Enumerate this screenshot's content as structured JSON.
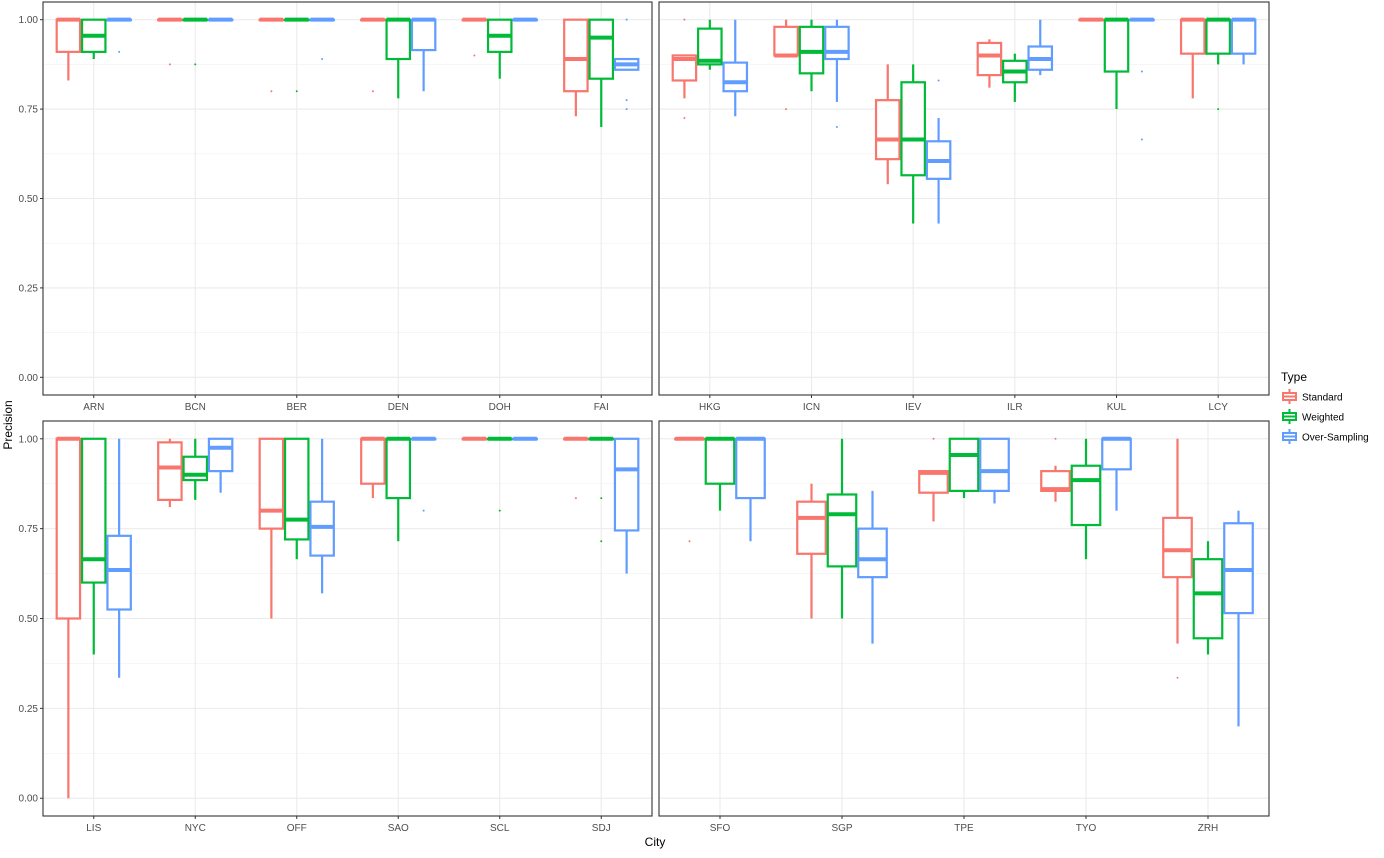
{
  "chart_data": {
    "type": "box",
    "x_axis_title": "City",
    "y_axis_title": "Precision",
    "y_ticks": [
      "0.00",
      "0.25",
      "0.50",
      "0.75",
      "1.00"
    ],
    "ylim": [
      0,
      1
    ],
    "grid": true,
    "legend": {
      "title": "Type",
      "position": "right",
      "items": [
        {
          "name": "Standard",
          "color": "#F8766D"
        },
        {
          "name": "Weighted",
          "color": "#00BA38"
        },
        {
          "name": "Over-Sampling",
          "color": "#619CFF"
        }
      ]
    },
    "panels": [
      {
        "cities": [
          {
            "city": "ARN",
            "boxes": [
              {
                "min": 0.83,
                "q1": 0.91,
                "median": 1.0,
                "q3": 1.0,
                "max": 1.0,
                "outliers": []
              },
              {
                "min": 0.89,
                "q1": 0.91,
                "median": 0.955,
                "q3": 1.0,
                "max": 1.0,
                "outliers": []
              },
              {
                "min": 1.0,
                "q1": 1.0,
                "median": 1.0,
                "q3": 1.0,
                "max": 1.0,
                "outliers": [
                  0.91
                ]
              }
            ]
          },
          {
            "city": "BCN",
            "boxes": [
              {
                "min": 1.0,
                "q1": 1.0,
                "median": 1.0,
                "q3": 1.0,
                "max": 1.0,
                "outliers": [
                  0.875
                ]
              },
              {
                "min": 1.0,
                "q1": 1.0,
                "median": 1.0,
                "q3": 1.0,
                "max": 1.0,
                "outliers": [
                  0.875
                ]
              },
              {
                "min": 1.0,
                "q1": 1.0,
                "median": 1.0,
                "q3": 1.0,
                "max": 1.0,
                "outliers": []
              }
            ]
          },
          {
            "city": "BER",
            "boxes": [
              {
                "min": 1.0,
                "q1": 1.0,
                "median": 1.0,
                "q3": 1.0,
                "max": 1.0,
                "outliers": [
                  0.8
                ]
              },
              {
                "min": 1.0,
                "q1": 1.0,
                "median": 1.0,
                "q3": 1.0,
                "max": 1.0,
                "outliers": [
                  0.8
                ]
              },
              {
                "min": 1.0,
                "q1": 1.0,
                "median": 1.0,
                "q3": 1.0,
                "max": 1.0,
                "outliers": [
                  0.89
                ]
              }
            ]
          },
          {
            "city": "DEN",
            "boxes": [
              {
                "min": 1.0,
                "q1": 1.0,
                "median": 1.0,
                "q3": 1.0,
                "max": 1.0,
                "outliers": [
                  0.8
                ]
              },
              {
                "min": 0.78,
                "q1": 0.89,
                "median": 1.0,
                "q3": 1.0,
                "max": 1.0,
                "outliers": []
              },
              {
                "min": 0.8,
                "q1": 0.915,
                "median": 1.0,
                "q3": 1.0,
                "max": 1.0,
                "outliers": []
              }
            ]
          },
          {
            "city": "DOH",
            "boxes": [
              {
                "min": 1.0,
                "q1": 1.0,
                "median": 1.0,
                "q3": 1.0,
                "max": 1.0,
                "outliers": [
                  0.9
                ]
              },
              {
                "min": 0.835,
                "q1": 0.91,
                "median": 0.955,
                "q3": 1.0,
                "max": 1.0,
                "outliers": []
              },
              {
                "min": 1.0,
                "q1": 1.0,
                "median": 1.0,
                "q3": 1.0,
                "max": 1.0,
                "outliers": []
              }
            ]
          },
          {
            "city": "FAI",
            "boxes": [
              {
                "min": 0.73,
                "q1": 0.8,
                "median": 0.89,
                "q3": 1.0,
                "max": 1.0,
                "outliers": []
              },
              {
                "min": 0.7,
                "q1": 0.835,
                "median": 0.95,
                "q3": 1.0,
                "max": 1.0,
                "outliers": []
              },
              {
                "min": 0.86,
                "q1": 0.86,
                "median": 0.875,
                "q3": 0.89,
                "max": 0.89,
                "outliers": [
                  1.0,
                  0.775,
                  0.75
                ]
              }
            ]
          }
        ]
      },
      {
        "cities": [
          {
            "city": "HKG",
            "boxes": [
              {
                "min": 0.78,
                "q1": 0.83,
                "median": 0.89,
                "q3": 0.9,
                "max": 0.9,
                "outliers": [
                  1.0,
                  0.725
                ]
              },
              {
                "min": 0.86,
                "q1": 0.875,
                "median": 0.885,
                "q3": 0.975,
                "max": 1.0,
                "outliers": []
              },
              {
                "min": 0.73,
                "q1": 0.8,
                "median": 0.825,
                "q3": 0.88,
                "max": 1.0,
                "outliers": []
              }
            ]
          },
          {
            "city": "ICN",
            "boxes": [
              {
                "min": 0.9,
                "q1": 0.9,
                "median": 0.9,
                "q3": 0.98,
                "max": 1.0,
                "outliers": [
                  0.75
                ]
              },
              {
                "min": 0.8,
                "q1": 0.85,
                "median": 0.91,
                "q3": 0.98,
                "max": 1.0,
                "outliers": []
              },
              {
                "min": 0.77,
                "q1": 0.89,
                "median": 0.91,
                "q3": 0.98,
                "max": 1.0,
                "outliers": [
                  0.7
                ]
              }
            ]
          },
          {
            "city": "IEV",
            "boxes": [
              {
                "min": 0.54,
                "q1": 0.61,
                "median": 0.665,
                "q3": 0.775,
                "max": 0.875,
                "outliers": []
              },
              {
                "min": 0.43,
                "q1": 0.565,
                "median": 0.665,
                "q3": 0.825,
                "max": 0.875,
                "outliers": []
              },
              {
                "min": 0.43,
                "q1": 0.555,
                "median": 0.605,
                "q3": 0.66,
                "max": 0.725,
                "outliers": [
                  0.83
                ]
              }
            ]
          },
          {
            "city": "ILR",
            "boxes": [
              {
                "min": 0.81,
                "q1": 0.845,
                "median": 0.9,
                "q3": 0.935,
                "max": 0.945,
                "outliers": []
              },
              {
                "min": 0.77,
                "q1": 0.825,
                "median": 0.855,
                "q3": 0.885,
                "max": 0.905,
                "outliers": []
              },
              {
                "min": 0.845,
                "q1": 0.86,
                "median": 0.89,
                "q3": 0.925,
                "max": 1.0,
                "outliers": []
              }
            ]
          },
          {
            "city": "KUL",
            "boxes": [
              {
                "min": 1.0,
                "q1": 1.0,
                "median": 1.0,
                "q3": 1.0,
                "max": 1.0,
                "outliers": []
              },
              {
                "min": 0.75,
                "q1": 0.855,
                "median": 1.0,
                "q3": 1.0,
                "max": 1.0,
                "outliers": []
              },
              {
                "min": 1.0,
                "q1": 1.0,
                "median": 1.0,
                "q3": 1.0,
                "max": 1.0,
                "outliers": [
                  0.855,
                  0.665
                ]
              }
            ]
          },
          {
            "city": "LCY",
            "boxes": [
              {
                "min": 0.78,
                "q1": 0.905,
                "median": 1.0,
                "q3": 1.0,
                "max": 1.0,
                "outliers": []
              },
              {
                "min": 0.875,
                "q1": 0.905,
                "median": 1.0,
                "q3": 1.0,
                "max": 1.0,
                "outliers": [
                  0.75
                ]
              },
              {
                "min": 0.875,
                "q1": 0.905,
                "median": 1.0,
                "q3": 1.0,
                "max": 1.0,
                "outliers": []
              }
            ]
          }
        ]
      },
      {
        "cities": [
          {
            "city": "LIS",
            "boxes": [
              {
                "min": 0.0,
                "q1": 0.5,
                "median": 1.0,
                "q3": 1.0,
                "max": 1.0,
                "outliers": []
              },
              {
                "min": 0.4,
                "q1": 0.6,
                "median": 0.665,
                "q3": 1.0,
                "max": 1.0,
                "outliers": []
              },
              {
                "min": 0.335,
                "q1": 0.525,
                "median": 0.635,
                "q3": 0.73,
                "max": 1.0,
                "outliers": []
              }
            ]
          },
          {
            "city": "NYC",
            "boxes": [
              {
                "min": 0.81,
                "q1": 0.83,
                "median": 0.92,
                "q3": 0.99,
                "max": 1.0,
                "outliers": []
              },
              {
                "min": 0.83,
                "q1": 0.885,
                "median": 0.9,
                "q3": 0.95,
                "max": 1.0,
                "outliers": []
              },
              {
                "min": 0.85,
                "q1": 0.91,
                "median": 0.975,
                "q3": 1.0,
                "max": 1.0,
                "outliers": []
              }
            ]
          },
          {
            "city": "OFF",
            "boxes": [
              {
                "min": 0.5,
                "q1": 0.75,
                "median": 0.8,
                "q3": 1.0,
                "max": 1.0,
                "outliers": []
              },
              {
                "min": 0.665,
                "q1": 0.72,
                "median": 0.775,
                "q3": 1.0,
                "max": 1.0,
                "outliers": []
              },
              {
                "min": 0.57,
                "q1": 0.675,
                "median": 0.755,
                "q3": 0.825,
                "max": 1.0,
                "outliers": []
              }
            ]
          },
          {
            "city": "SAO",
            "boxes": [
              {
                "min": 0.835,
                "q1": 0.875,
                "median": 1.0,
                "q3": 1.0,
                "max": 1.0,
                "outliers": []
              },
              {
                "min": 0.715,
                "q1": 0.835,
                "median": 1.0,
                "q3": 1.0,
                "max": 1.0,
                "outliers": []
              },
              {
                "min": 1.0,
                "q1": 1.0,
                "median": 1.0,
                "q3": 1.0,
                "max": 1.0,
                "outliers": [
                  0.8
                ]
              }
            ]
          },
          {
            "city": "SCL",
            "boxes": [
              {
                "min": 1.0,
                "q1": 1.0,
                "median": 1.0,
                "q3": 1.0,
                "max": 1.0,
                "outliers": []
              },
              {
                "min": 1.0,
                "q1": 1.0,
                "median": 1.0,
                "q3": 1.0,
                "max": 1.0,
                "outliers": [
                  0.8
                ]
              },
              {
                "min": 1.0,
                "q1": 1.0,
                "median": 1.0,
                "q3": 1.0,
                "max": 1.0,
                "outliers": []
              }
            ]
          },
          {
            "city": "SDJ",
            "boxes": [
              {
                "min": 1.0,
                "q1": 1.0,
                "median": 1.0,
                "q3": 1.0,
                "max": 1.0,
                "outliers": [
                  0.835
                ]
              },
              {
                "min": 1.0,
                "q1": 1.0,
                "median": 1.0,
                "q3": 1.0,
                "max": 1.0,
                "outliers": [
                  0.835,
                  0.715
                ]
              },
              {
                "min": 0.625,
                "q1": 0.745,
                "median": 0.915,
                "q3": 1.0,
                "max": 1.0,
                "outliers": []
              }
            ]
          }
        ]
      },
      {
        "cities": [
          {
            "city": "SFO",
            "boxes": [
              {
                "min": 1.0,
                "q1": 1.0,
                "median": 1.0,
                "q3": 1.0,
                "max": 1.0,
                "outliers": [
                  0.715
                ]
              },
              {
                "min": 0.8,
                "q1": 0.875,
                "median": 1.0,
                "q3": 1.0,
                "max": 1.0,
                "outliers": []
              },
              {
                "min": 0.715,
                "q1": 0.835,
                "median": 1.0,
                "q3": 1.0,
                "max": 1.0,
                "outliers": []
              }
            ]
          },
          {
            "city": "SGP",
            "boxes": [
              {
                "min": 0.5,
                "q1": 0.68,
                "median": 0.78,
                "q3": 0.825,
                "max": 0.875,
                "outliers": []
              },
              {
                "min": 0.5,
                "q1": 0.645,
                "median": 0.79,
                "q3": 0.845,
                "max": 1.0,
                "outliers": []
              },
              {
                "min": 0.43,
                "q1": 0.615,
                "median": 0.665,
                "q3": 0.75,
                "max": 0.855,
                "outliers": []
              }
            ]
          },
          {
            "city": "TPE",
            "boxes": [
              {
                "min": 0.77,
                "q1": 0.85,
                "median": 0.905,
                "q3": 0.91,
                "max": 0.91,
                "outliers": [
                  1.0
                ]
              },
              {
                "min": 0.835,
                "q1": 0.855,
                "median": 0.955,
                "q3": 1.0,
                "max": 1.0,
                "outliers": []
              },
              {
                "min": 0.82,
                "q1": 0.855,
                "median": 0.91,
                "q3": 1.0,
                "max": 1.0,
                "outliers": []
              }
            ]
          },
          {
            "city": "TYO",
            "boxes": [
              {
                "min": 0.825,
                "q1": 0.855,
                "median": 0.86,
                "q3": 0.91,
                "max": 0.925,
                "outliers": [
                  1.0
                ]
              },
              {
                "min": 0.665,
                "q1": 0.76,
                "median": 0.885,
                "q3": 0.925,
                "max": 1.0,
                "outliers": []
              },
              {
                "min": 0.8,
                "q1": 0.915,
                "median": 1.0,
                "q3": 1.0,
                "max": 1.0,
                "outliers": []
              }
            ]
          },
          {
            "city": "ZRH",
            "boxes": [
              {
                "min": 0.43,
                "q1": 0.615,
                "median": 0.69,
                "q3": 0.78,
                "max": 1.0,
                "outliers": [
                  0.335
                ]
              },
              {
                "min": 0.4,
                "q1": 0.445,
                "median": 0.57,
                "q3": 0.665,
                "max": 0.715,
                "outliers": []
              },
              {
                "min": 0.2,
                "q1": 0.515,
                "median": 0.635,
                "q3": 0.765,
                "max": 0.8,
                "outliers": []
              }
            ]
          }
        ]
      }
    ]
  }
}
